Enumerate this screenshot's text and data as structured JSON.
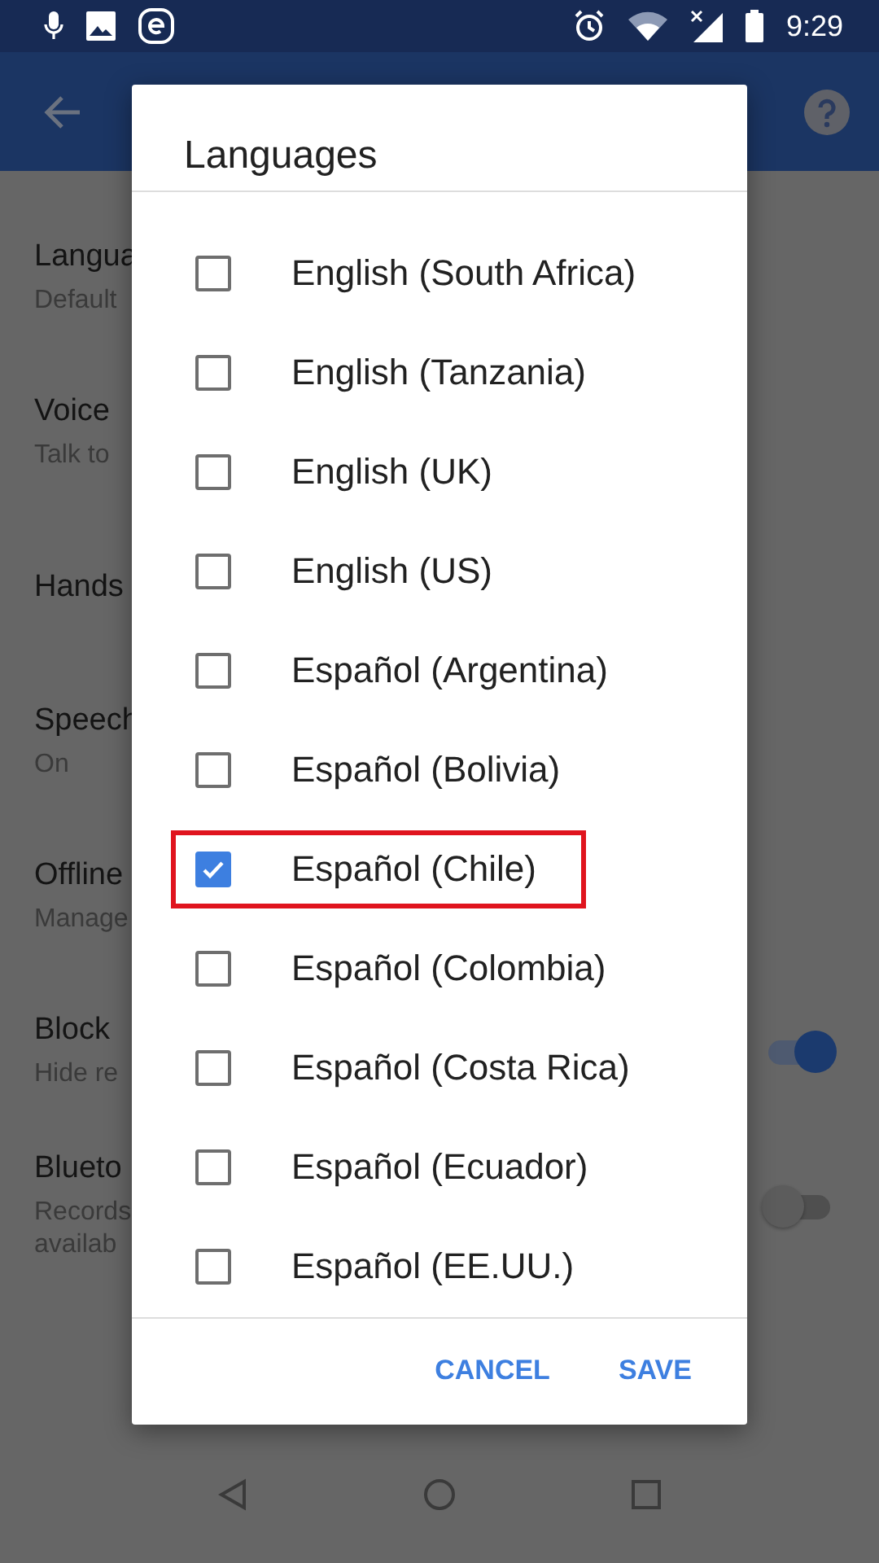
{
  "status_bar": {
    "time": "9:29"
  },
  "settings": [
    {
      "kind": "plain",
      "title": "Langua",
      "subtitle": "Default"
    },
    {
      "kind": "plain",
      "title": "Voice",
      "subtitle": "Talk to"
    },
    {
      "kind": "plain",
      "title": "Hands"
    },
    {
      "kind": "plain",
      "title": "Speech",
      "subtitle": "On"
    },
    {
      "kind": "plain",
      "title": "Offline",
      "subtitle": "Manage"
    },
    {
      "kind": "toggle",
      "title": "Block",
      "subtitle": "Hide re",
      "on": true
    },
    {
      "kind": "toggle",
      "title": "Blueto",
      "subtitle": "Records\navailab",
      "on": false
    }
  ],
  "dialog": {
    "title": "Languages",
    "items": [
      {
        "label": "English (South Africa)",
        "checked": false,
        "highlighted": false
      },
      {
        "label": "English (Tanzania)",
        "checked": false,
        "highlighted": false
      },
      {
        "label": "English (UK)",
        "checked": false,
        "highlighted": false
      },
      {
        "label": "English (US)",
        "checked": false,
        "highlighted": false
      },
      {
        "label": "Español (Argentina)",
        "checked": false,
        "highlighted": false
      },
      {
        "label": "Español (Bolivia)",
        "checked": false,
        "highlighted": false
      },
      {
        "label": "Español (Chile)",
        "checked": true,
        "highlighted": true
      },
      {
        "label": "Español (Colombia)",
        "checked": false,
        "highlighted": false
      },
      {
        "label": "Español (Costa Rica)",
        "checked": false,
        "highlighted": false
      },
      {
        "label": "Español (Ecuador)",
        "checked": false,
        "highlighted": false
      },
      {
        "label": "Español (EE.UU.)",
        "checked": false,
        "highlighted": false
      }
    ],
    "buttons": [
      "CANCEL",
      "SAVE"
    ]
  }
}
